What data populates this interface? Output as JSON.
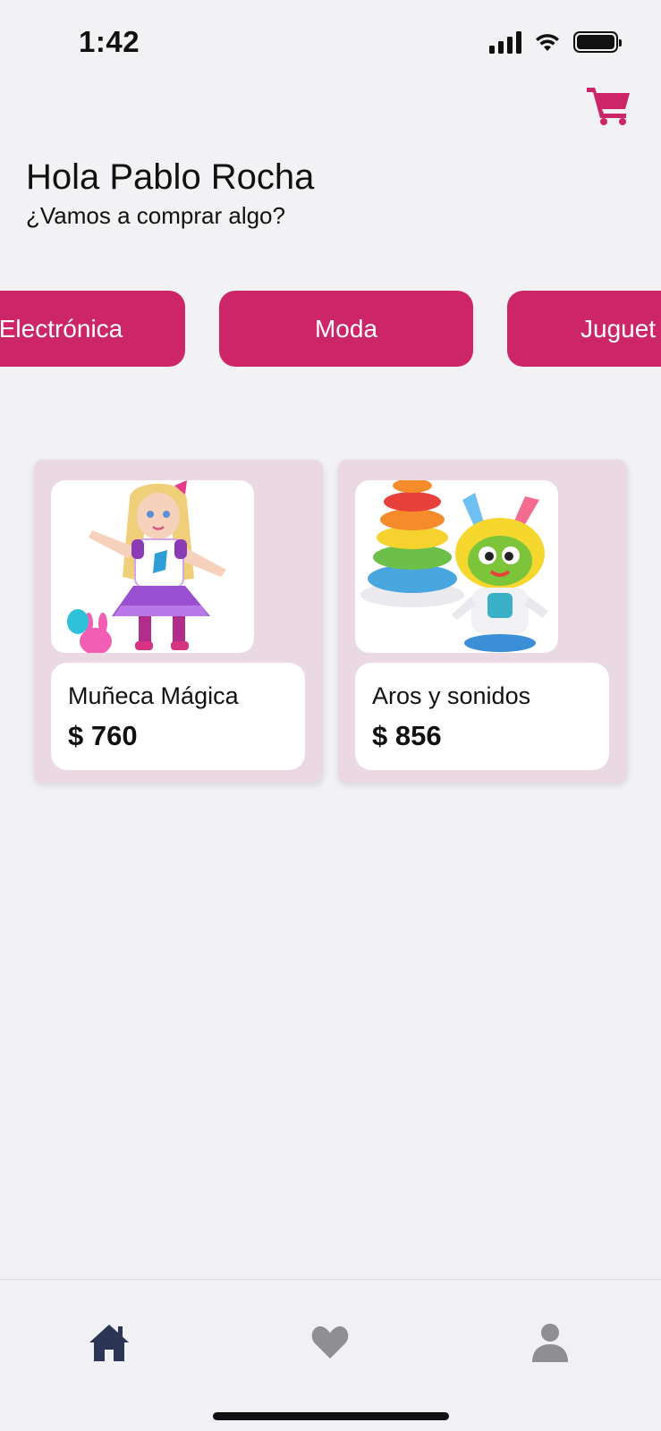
{
  "status_bar": {
    "time": "1:42",
    "icons": [
      "cellular-signal-icon",
      "wifi-icon",
      "battery-icon"
    ]
  },
  "header": {
    "cart_icon": "shopping-cart-icon"
  },
  "greeting": {
    "title": "Hola Pablo Rocha",
    "subtitle": "¿Vamos a comprar algo?"
  },
  "categories": [
    {
      "label": "Electrónica"
    },
    {
      "label": "Moda"
    },
    {
      "label": "Juguet"
    }
  ],
  "products": [
    {
      "name": "Muñeca Mágica",
      "price": "$ 760",
      "image": "doll-toy-image"
    },
    {
      "name": "Aros y sonidos",
      "price": "$ 856",
      "image": "stacking-rings-robot-toy-image"
    }
  ],
  "tab_bar": {
    "items": [
      {
        "icon": "home-icon",
        "active": true
      },
      {
        "icon": "heart-icon",
        "active": false
      },
      {
        "icon": "person-icon",
        "active": false
      }
    ]
  },
  "colors": {
    "accent": "#cc2568",
    "background": "#f2f2f4",
    "card_background": "#ead9e2",
    "tab_active": "#2c3553",
    "tab_inactive": "#8e8e93"
  }
}
